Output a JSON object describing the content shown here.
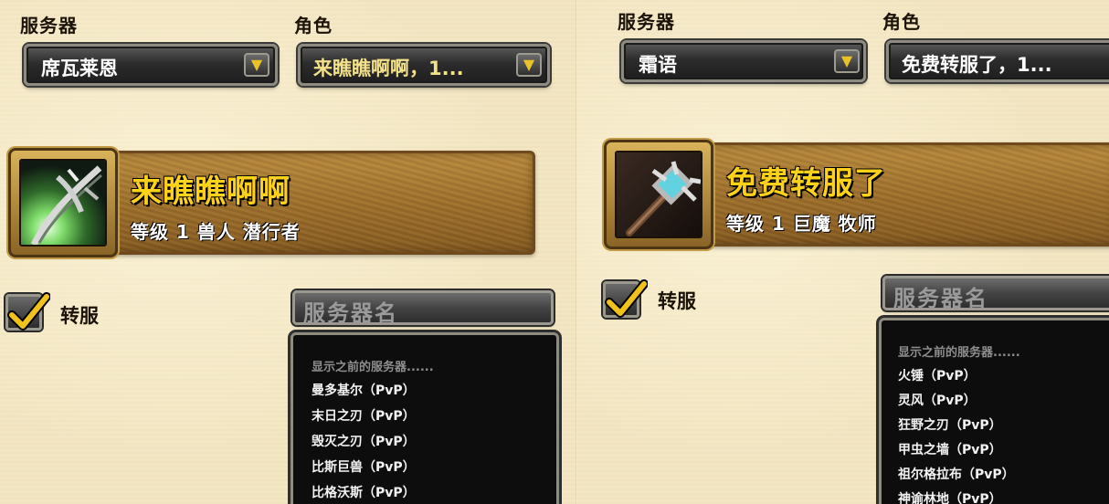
{
  "left": {
    "server_label": "服务器",
    "server_value": "席瓦莱恩",
    "role_label": "角色",
    "role_value": "来瞧瞧啊啊，1...",
    "character": {
      "name": "来瞧瞧啊啊",
      "info": "等级 1 兽人 潜行者"
    },
    "transfer_label": "转服",
    "transfer_checked": true,
    "server_name_placeholder": "服务器名",
    "list_hint": "显示之前的服务器......",
    "servers": [
      "曼多基尔（PvP）",
      "末日之刃（PvP）",
      "毁灭之刃（PvP）",
      "比斯巨兽（PvP）",
      "比格沃斯（PvP）"
    ]
  },
  "right": {
    "server_label": "服务器",
    "server_value": "霜语",
    "role_label": "角色",
    "role_value": "免费转服了，1...",
    "character": {
      "name": "免费转服了",
      "info": "等级 1 巨魔 牧师"
    },
    "transfer_label": "转服",
    "transfer_checked": true,
    "server_name_placeholder": "服务器名",
    "list_hint": "显示之前的服务器......",
    "servers": [
      "火锤（PvP）",
      "灵风（PvP）",
      "狂野之刃（PvP）",
      "甲虫之墙（PvP）",
      "祖尔格拉布（PvP）",
      "神谕林地（PvP）"
    ]
  },
  "icons": {
    "dropdown_arrow": "arrow-down-icon",
    "check": "checkmark-icon",
    "left_portrait": "rogue-dagger-icon",
    "right_portrait": "priest-mace-icon"
  },
  "colors": {
    "parchment": "#f3e6c3",
    "gold_text": "#ffd21a",
    "pale_gold_text": "#f3e08a",
    "banner_brown": "#9b6d2a"
  }
}
